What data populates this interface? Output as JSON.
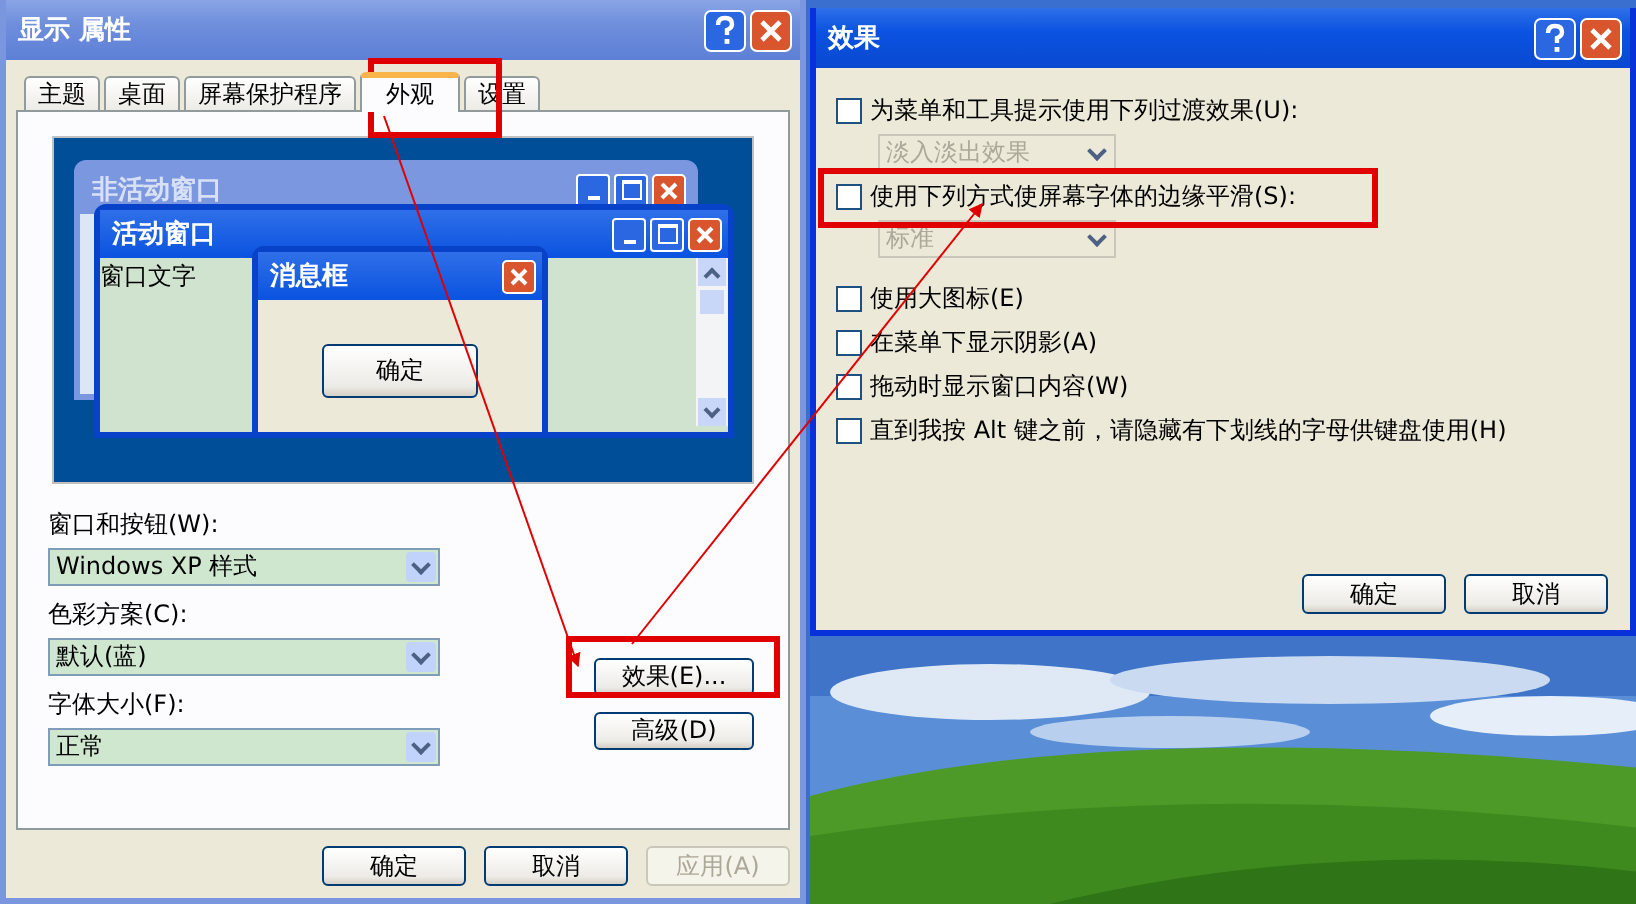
{
  "display_properties": {
    "title": "显示 属性",
    "tabs": [
      {
        "label": "主题",
        "selected": false
      },
      {
        "label": "桌面",
        "selected": false
      },
      {
        "label": "屏幕保护程序",
        "selected": false
      },
      {
        "label": "外观",
        "selected": true
      },
      {
        "label": "设置",
        "selected": false
      }
    ],
    "preview": {
      "inactive_title": "非活动窗口",
      "active_title": "活动窗口",
      "window_text": "窗口文字",
      "message_title": "消息框",
      "message_button": "确定"
    },
    "fields": [
      {
        "label": "窗口和按钮(W):",
        "value": "Windows XP 样式"
      },
      {
        "label": "色彩方案(C):",
        "value": "默认(蓝)"
      },
      {
        "label": "字体大小(F):",
        "value": "正常"
      }
    ],
    "side_buttons": [
      "效果(E)...",
      "高级(D)"
    ],
    "buttons": [
      {
        "label": "确定",
        "disabled": false
      },
      {
        "label": "取消",
        "disabled": false
      },
      {
        "label": "应用(A)",
        "disabled": true
      }
    ]
  },
  "effects_dialog": {
    "title": "效果",
    "options": [
      {
        "kind": "checkbox",
        "label": "为菜单和工具提示使用下列过渡效果(U):",
        "checked": false
      },
      {
        "kind": "dropdown",
        "value": "淡入淡出效果",
        "disabled": true
      },
      {
        "kind": "checkbox",
        "label": "使用下列方式使屏幕字体的边缘平滑(S):",
        "checked": false
      },
      {
        "kind": "dropdown",
        "value": "标准",
        "disabled": true
      },
      {
        "kind": "checkbox",
        "label": "使用大图标(E)",
        "checked": false
      },
      {
        "kind": "checkbox",
        "label": "在菜单下显示阴影(A)",
        "checked": false
      },
      {
        "kind": "checkbox",
        "label": "拖动时显示窗口内容(W)",
        "checked": false
      },
      {
        "kind": "checkbox",
        "label": "直到我按 Alt 键之前，请隐藏有下划线的字母供键盘使用(H)",
        "checked": false
      }
    ],
    "buttons": [
      "确定",
      "取消"
    ]
  }
}
